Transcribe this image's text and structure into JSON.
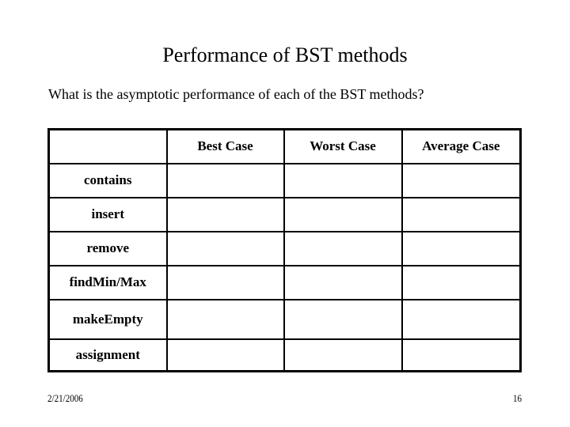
{
  "slide": {
    "title": "Performance of BST methods",
    "question": "What is the asymptotic performance of each of the BST methods?"
  },
  "table": {
    "corner": "",
    "columns": [
      "Best Case",
      "Worst Case",
      "Average Case"
    ],
    "rows": [
      {
        "method": "contains",
        "best": "",
        "worst": "",
        "average": ""
      },
      {
        "method": "insert",
        "best": "",
        "worst": "",
        "average": ""
      },
      {
        "method": "remove",
        "best": "",
        "worst": "",
        "average": ""
      },
      {
        "method": "findMin/Max",
        "best": "",
        "worst": "",
        "average": ""
      },
      {
        "method": "makeEmpty",
        "best": "",
        "worst": "",
        "average": ""
      },
      {
        "method": "assignment",
        "best": "",
        "worst": "",
        "average": ""
      }
    ]
  },
  "footer": {
    "date": "2/21/2006",
    "page_number": "16"
  }
}
